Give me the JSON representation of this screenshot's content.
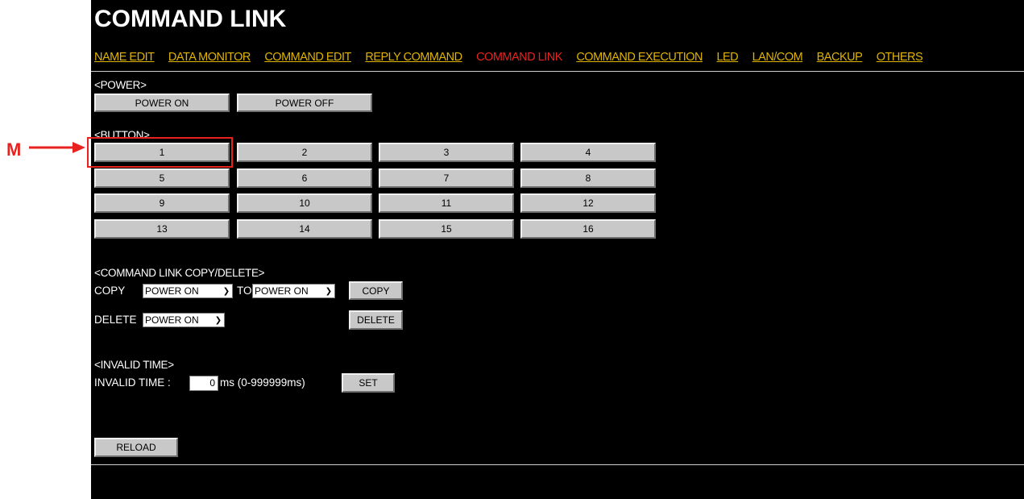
{
  "header": {
    "title": "COMMAND LINK"
  },
  "nav": [
    {
      "label": "NAME EDIT",
      "active": false
    },
    {
      "label": "DATA MONITOR",
      "active": false
    },
    {
      "label": "COMMAND EDIT",
      "active": false
    },
    {
      "label": "REPLY COMMAND",
      "active": false
    },
    {
      "label": "COMMAND LINK",
      "active": true
    },
    {
      "label": "COMMAND EXECUTION",
      "active": false
    },
    {
      "label": "LED",
      "active": false
    },
    {
      "label": "LAN/COM",
      "active": false
    },
    {
      "label": "BACKUP",
      "active": false
    },
    {
      "label": "OTHERS",
      "active": false
    }
  ],
  "power": {
    "label": "<POWER>",
    "buttons": [
      "POWER ON",
      "POWER OFF"
    ]
  },
  "button_section": {
    "label": "<BUTTON>",
    "buttons": [
      "1",
      "2",
      "3",
      "4",
      "5",
      "6",
      "7",
      "8",
      "9",
      "10",
      "11",
      "12",
      "13",
      "14",
      "15",
      "16"
    ]
  },
  "copy_delete": {
    "label": "<COMMAND LINK COPY/DELETE>",
    "copy_label": "COPY",
    "copy_from": "POWER ON",
    "to_label": "TO",
    "copy_to": "POWER ON",
    "copy_button": "COPY",
    "delete_label": "DELETE",
    "delete_target": "POWER ON",
    "delete_button": "DELETE"
  },
  "invalid_time": {
    "label": "<INVALID TIME>",
    "field_label": "INVALID TIME :",
    "value": "0",
    "unit": "ms (0-999999ms)",
    "set_button": "SET"
  },
  "reload_button": "RELOAD",
  "annotation": {
    "label": "M",
    "color": "#e8231f"
  },
  "colors": {
    "background": "#000000",
    "nav_link": "#e0b400",
    "nav_active": "#e8231f",
    "button": "#c8c8c8"
  }
}
